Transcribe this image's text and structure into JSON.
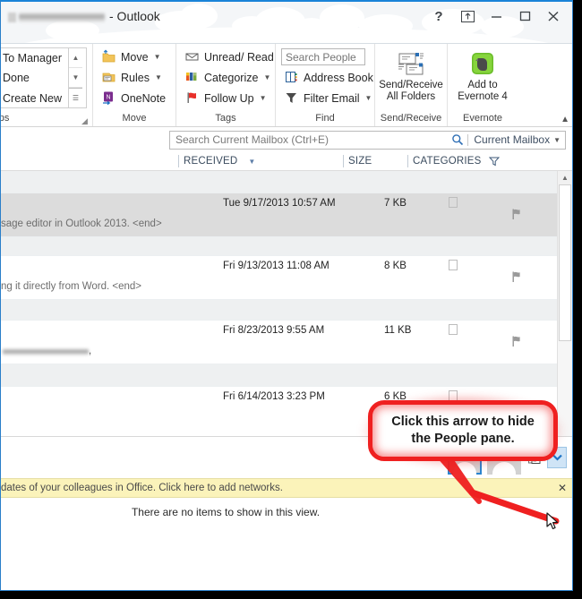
{
  "window": {
    "title_suffix": "- Outlook",
    "title_redacted": true,
    "controls": {
      "help": "?",
      "ribbon_display": "Ribbon Display Options",
      "minimize": "Minimize",
      "restore": "Restore Down",
      "close": "Close"
    }
  },
  "ribbon": {
    "collapse_label": "Collapse the Ribbon",
    "groups": [
      {
        "name": "quick-steps",
        "label": "teps",
        "full_label": "Quick Steps",
        "has_dialog_launcher": true,
        "items": [
          {
            "label": "To Manager",
            "icon": "to-manager-icon"
          },
          {
            "label": "Done",
            "icon": "done-icon"
          },
          {
            "label": "Create New",
            "icon": "create-new-icon"
          }
        ],
        "scroll_buttons": [
          "▴",
          "▾",
          "☰"
        ]
      },
      {
        "name": "move",
        "label": "Move",
        "items": [
          {
            "label": "Move",
            "icon": "move-folder-icon",
            "dropdown": true
          },
          {
            "label": "Rules",
            "icon": "rules-icon",
            "dropdown": true
          },
          {
            "label": "OneNote",
            "icon": "onenote-icon",
            "dropdown": false
          }
        ]
      },
      {
        "name": "tags",
        "label": "Tags",
        "items": [
          {
            "label": "Unread/ Read",
            "icon": "envelope-icon",
            "dropdown": false
          },
          {
            "label": "Categorize",
            "icon": "categorize-icon",
            "dropdown": true
          },
          {
            "label": "Follow Up",
            "icon": "flag-icon",
            "dropdown": true
          }
        ]
      },
      {
        "name": "find",
        "label": "Find",
        "search_people_placeholder": "Search People",
        "items": [
          {
            "label": "Address Book",
            "icon": "address-book-icon",
            "dropdown": false
          },
          {
            "label": "Filter Email",
            "icon": "funnel-icon",
            "dropdown": true
          }
        ]
      },
      {
        "name": "send-receive",
        "label": "Send/Receive",
        "button": {
          "label_line1": "Send/Receive",
          "label_line2": "All Folders",
          "icon": "send-receive-icon"
        }
      },
      {
        "name": "evernote",
        "label": "Evernote",
        "button": {
          "label_line1": "Add to",
          "label_line2": "Evernote 4",
          "icon": "evernote-elephant-icon"
        }
      }
    ]
  },
  "search": {
    "placeholder": "Search Current Mailbox (Ctrl+E)",
    "scope": "Current Mailbox",
    "magnifier_icon": "search-icon",
    "scope_caret_icon": "chevron-down-icon"
  },
  "columns": [
    {
      "label": "",
      "name": "icon-column"
    },
    {
      "label": "RECEIVED",
      "name": "received-column",
      "sorted": true,
      "sort_icon": "sort-descending-icon"
    },
    {
      "label": "SIZE",
      "name": "size-column"
    },
    {
      "label": "CATEGORIES",
      "name": "categories-column",
      "filter_icon": "filter-icon"
    }
  ],
  "messages": [
    {
      "received": "Tue 9/17/2013 10:57 AM",
      "size": "7 KB",
      "preview": "sage editor in Outlook 2013. <end>",
      "selected": true,
      "flagged": true,
      "sender_redacted": false
    },
    {
      "received": "Fri 9/13/2013 11:08 AM",
      "size": "8 KB",
      "preview": "ng it directly from Word. <end>",
      "selected": false,
      "flagged": true,
      "sender_redacted": false
    },
    {
      "received": "Fri 8/23/2013 9:55 AM",
      "size": "11 KB",
      "preview": "",
      "selected": false,
      "flagged": true,
      "sender_redacted": true
    },
    {
      "received": "Fri 6/14/2013 3:23 PM",
      "size": "6 KB",
      "preview": "",
      "selected": false,
      "flagged": false,
      "sender_redacted": false
    }
  ],
  "callout": {
    "text": "Click this arrow to hide the People pane.",
    "line1": "Click this arrow to hide",
    "line2": "the People pane.",
    "border_color": "#ef2020",
    "points_to": "people-pane-collapse-button"
  },
  "people_pane": {
    "avatars": [
      {
        "name": "avatar-primary",
        "selected": true
      },
      {
        "name": "avatar-secondary",
        "selected": false
      }
    ],
    "add_contact_icon": "add-contact-icon",
    "collapse_icon": "chevron-down-icon"
  },
  "notification": {
    "text": "dates of your colleagues in Office. Click here to add networks.",
    "close_label": "✕",
    "background": "#fbf3ba"
  },
  "empty_view": {
    "text": "There are no items to show in this view."
  }
}
